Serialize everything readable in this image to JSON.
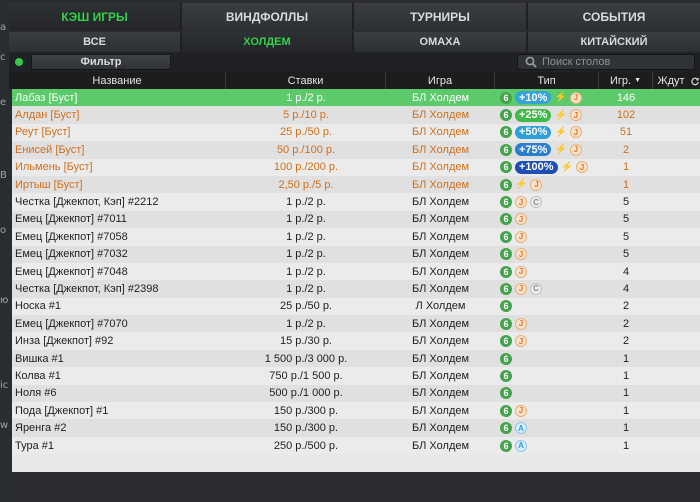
{
  "main_tabs": [
    {
      "label": "КЭШ ИГРЫ",
      "active": true
    },
    {
      "label": "ВИНДФОЛЛЫ",
      "active": false
    },
    {
      "label": "ТУРНИРЫ",
      "active": false
    },
    {
      "label": "СОБЫТИЯ",
      "active": false
    }
  ],
  "game_tabs": [
    {
      "label": "ВСЕ",
      "active": false
    },
    {
      "label": "ХОЛДЕМ",
      "active": true
    },
    {
      "label": "ОМАХА",
      "active": false
    },
    {
      "label": "КИТАЙСКИЙ",
      "active": false
    }
  ],
  "filter": {
    "label": "Фильтр"
  },
  "search": {
    "placeholder": "Поиск столов"
  },
  "table": {
    "columns": [
      "Название",
      "Ставки",
      "Игра",
      "Тип",
      "Игр.",
      "Ждут"
    ],
    "sort_indicator": "▼",
    "rows": [
      {
        "name": "Лабаз [Буст]",
        "stakes": "1 р./2 р.",
        "game": "БЛ Холдем",
        "bonus": "+10%",
        "bonus_color": "#36a3d9",
        "J": true,
        "C": false,
        "A": false,
        "players": "146",
        "selected": true,
        "orange": true
      },
      {
        "name": "Алдан [Буст]",
        "stakes": "5 р./10 р.",
        "game": "БЛ Холдем",
        "bonus": "+25%",
        "bonus_color": "#3eb94a",
        "J": true,
        "C": false,
        "A": false,
        "players": "102",
        "selected": false,
        "orange": true
      },
      {
        "name": "Реут [Буст]",
        "stakes": "25 р./50 р.",
        "game": "БЛ Холдем",
        "bonus": "+50%",
        "bonus_color": "#2b9fd8",
        "J": true,
        "C": false,
        "A": false,
        "players": "51",
        "selected": false,
        "orange": true
      },
      {
        "name": "Енисей [Буст]",
        "stakes": "50 р./100 р.",
        "game": "БЛ Холдем",
        "bonus": "+75%",
        "bonus_color": "#2a80cf",
        "J": true,
        "C": false,
        "A": false,
        "players": "2",
        "selected": false,
        "orange": true
      },
      {
        "name": "Ильмень [Буст]",
        "stakes": "100 р./200 р.",
        "game": "БЛ Холдем",
        "bonus": "+100%",
        "bonus_color": "#1e4fb2",
        "J": true,
        "C": false,
        "A": false,
        "players": "1",
        "selected": false,
        "orange": true
      },
      {
        "name": "Иртыш [Буст]",
        "stakes": "2,50 р./5 р.",
        "game": "БЛ Холдем",
        "bonus": "",
        "bonus_color": "",
        "J": true,
        "C": false,
        "A": false,
        "players": "1",
        "selected": false,
        "orange": true
      },
      {
        "name": "Честка [Джекпот, Кэп] #2212",
        "stakes": "1 р./2 р.",
        "game": "БЛ Холдем",
        "bonus": "",
        "bonus_color": "",
        "J": true,
        "C": true,
        "A": false,
        "players": "5",
        "selected": false,
        "orange": false
      },
      {
        "name": "Емец [Джекпот] #7011",
        "stakes": "1 р./2 р.",
        "game": "БЛ Холдем",
        "bonus": "",
        "bonus_color": "",
        "J": true,
        "C": false,
        "A": false,
        "players": "5",
        "selected": false,
        "orange": false
      },
      {
        "name": "Емец [Джекпот] #7058",
        "stakes": "1 р./2 р.",
        "game": "БЛ Холдем",
        "bonus": "",
        "bonus_color": "",
        "J": true,
        "C": false,
        "A": false,
        "players": "5",
        "selected": false,
        "orange": false
      },
      {
        "name": "Емец [Джекпот] #7032",
        "stakes": "1 р./2 р.",
        "game": "БЛ Холдем",
        "bonus": "",
        "bonus_color": "",
        "J": true,
        "C": false,
        "A": false,
        "players": "5",
        "selected": false,
        "orange": false
      },
      {
        "name": "Емец [Джекпот] #7048",
        "stakes": "1 р./2 р.",
        "game": "БЛ Холдем",
        "bonus": "",
        "bonus_color": "",
        "J": true,
        "C": false,
        "A": false,
        "players": "4",
        "selected": false,
        "orange": false
      },
      {
        "name": "Честка [Джекпот, Кэп] #2398",
        "stakes": "1 р./2 р.",
        "game": "БЛ Холдем",
        "bonus": "",
        "bonus_color": "",
        "J": true,
        "C": true,
        "A": false,
        "players": "4",
        "selected": false,
        "orange": false
      },
      {
        "name": "Носка #1",
        "stakes": "25 р./50 р.",
        "game": "Л Холдем",
        "bonus": "",
        "bonus_color": "",
        "J": false,
        "C": false,
        "A": false,
        "players": "2",
        "selected": false,
        "orange": false
      },
      {
        "name": "Емец [Джекпот] #7070",
        "stakes": "1 р./2 р.",
        "game": "БЛ Холдем",
        "bonus": "",
        "bonus_color": "",
        "J": true,
        "C": false,
        "A": false,
        "players": "2",
        "selected": false,
        "orange": false
      },
      {
        "name": "Инза [Джекпот] #92",
        "stakes": "15 р./30 р.",
        "game": "БЛ Холдем",
        "bonus": "",
        "bonus_color": "",
        "J": true,
        "C": false,
        "A": false,
        "players": "2",
        "selected": false,
        "orange": false
      },
      {
        "name": "Вишка #1",
        "stakes": "1 500 р./3 000 р.",
        "game": "БЛ Холдем",
        "bonus": "",
        "bonus_color": "",
        "J": false,
        "C": false,
        "A": false,
        "players": "1",
        "selected": false,
        "orange": false
      },
      {
        "name": "Колва #1",
        "stakes": "750 р./1 500 р.",
        "game": "БЛ Холдем",
        "bonus": "",
        "bonus_color": "",
        "J": false,
        "C": false,
        "A": false,
        "players": "1",
        "selected": false,
        "orange": false
      },
      {
        "name": "Ноля #6",
        "stakes": "500 р./1 000 р.",
        "game": "БЛ Холдем",
        "bonus": "",
        "bonus_color": "",
        "J": false,
        "C": false,
        "A": false,
        "players": "1",
        "selected": false,
        "orange": false
      },
      {
        "name": "Пода [Джекпот] #1",
        "stakes": "150 р./300 р.",
        "game": "БЛ Холдем",
        "bonus": "",
        "bonus_color": "",
        "J": true,
        "C": false,
        "A": false,
        "players": "1",
        "selected": false,
        "orange": false
      },
      {
        "name": "Яренга #2",
        "stakes": "150 р./300 р.",
        "game": "БЛ Холдем",
        "bonus": "",
        "bonus_color": "",
        "J": false,
        "C": false,
        "A": true,
        "players": "1",
        "selected": false,
        "orange": false
      },
      {
        "name": "Тура #1",
        "stakes": "250 р./500 р.",
        "game": "БЛ Холдем",
        "bonus": "",
        "bonus_color": "",
        "J": false,
        "C": false,
        "A": true,
        "players": "1",
        "selected": false,
        "orange": false
      }
    ]
  },
  "badges": {
    "six": "6",
    "jackpot": "J",
    "cap": "C",
    "auto": "A",
    "bolt": "⚡"
  },
  "left_strip": [
    "a",
    "c",
    "e",
    "B",
    "o",
    "ю",
    "ic",
    "w"
  ],
  "colors": {
    "active_tab": "#33d04a",
    "selected_row": "#5cc96b",
    "boost_text": "#d0701a",
    "six_badge": "#45a34e"
  }
}
